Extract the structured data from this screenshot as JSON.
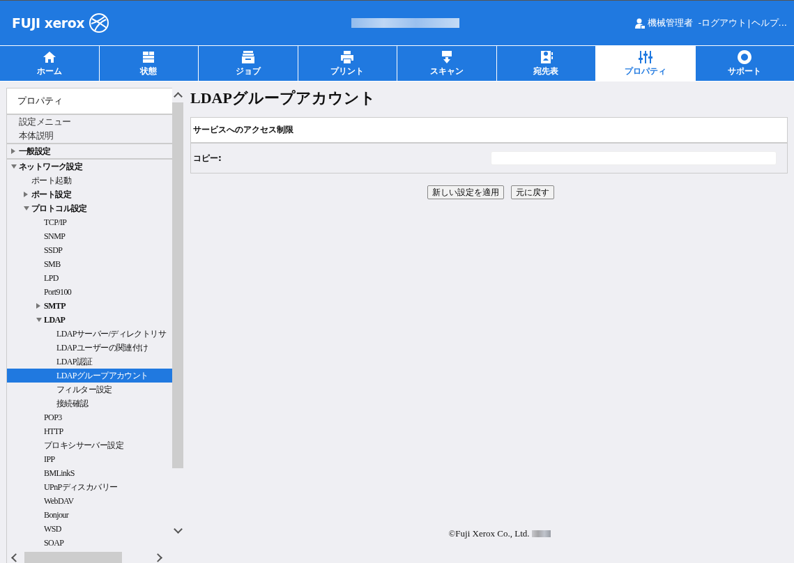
{
  "header": {
    "logo": "FUJI xerox",
    "user": "機械管理者",
    "links": [
      {
        "label": "-ログアウト"
      },
      {
        "label": "|",
        "kind": "separator"
      },
      {
        "label": "ヘルプ..."
      }
    ]
  },
  "tabs": [
    {
      "label": "ホーム",
      "selected": false
    },
    {
      "label": "状態",
      "selected": false
    },
    {
      "label": "ジョブ",
      "selected": false
    },
    {
      "label": "プリント",
      "selected": false
    },
    {
      "label": "スキャン",
      "selected": false
    },
    {
      "label": "宛先表",
      "selected": false
    },
    {
      "label": "プロパティ",
      "selected": true
    },
    {
      "label": "サポート",
      "selected": false
    }
  ],
  "sidebar": {
    "title": "プロパティ",
    "items": [
      {
        "label": "設定メニュー",
        "kind": "link",
        "selected": false
      },
      {
        "label": "本体説明",
        "kind": "link",
        "selected": false
      },
      {
        "label": "一般設定",
        "kind": "section",
        "expanded": false,
        "selected": false
      },
      {
        "label": "ネットワーク設定",
        "kind": "section",
        "expanded": true,
        "selected": false,
        "children": [
          {
            "label": "ポート起動",
            "selected": false
          },
          {
            "label": "ポート設定",
            "expanded": false,
            "selected": false
          },
          {
            "label": "プロトコル設定",
            "expanded": true,
            "selected": false,
            "children": [
              {
                "label": "TCP/IP",
                "selected": false
              },
              {
                "label": "SNMP",
                "selected": false
              },
              {
                "label": "SSDP",
                "selected": false
              },
              {
                "label": "SMB",
                "selected": false
              },
              {
                "label": "LPD",
                "selected": false
              },
              {
                "label": "Port9100",
                "selected": false
              },
              {
                "label": "SMTP",
                "expanded": false,
                "selected": false
              },
              {
                "label": "LDAP",
                "expanded": true,
                "selected": false,
                "children": [
                  {
                    "label": "LDAPサーバー/ディレクトリサ",
                    "selected": false
                  },
                  {
                    "label": "LDAPユーザーの関連付け",
                    "selected": false
                  },
                  {
                    "label": "LDAP認証",
                    "selected": false
                  },
                  {
                    "label": "LDAPグループアカウント",
                    "selected": true
                  },
                  {
                    "label": "フィルター設定",
                    "selected": false
                  },
                  {
                    "label": "接続確認",
                    "selected": false
                  }
                ]
              },
              {
                "label": "POP3",
                "selected": false
              },
              {
                "label": "HTTP",
                "selected": false
              },
              {
                "label": "プロキシサーバー設定",
                "selected": false
              },
              {
                "label": "IPP",
                "selected": false
              },
              {
                "label": "BMLinkS",
                "selected": false
              },
              {
                "label": "UPnPディスカバリー",
                "selected": false
              },
              {
                "label": "WebDAV",
                "selected": false
              },
              {
                "label": "Bonjour",
                "selected": false
              },
              {
                "label": "WSD",
                "selected": false
              },
              {
                "label": "SOAP",
                "selected": false
              }
            ]
          }
        ]
      }
    ]
  },
  "content": {
    "title": "LDAPグループアカウント",
    "section": "サービスへのアクセス制限",
    "fields": [
      {
        "label": "コピー:"
      }
    ],
    "buttons": [
      "新しい設定を適用",
      "元に戻す"
    ]
  },
  "footer": "©Fuji Xerox Co., Ltd."
}
